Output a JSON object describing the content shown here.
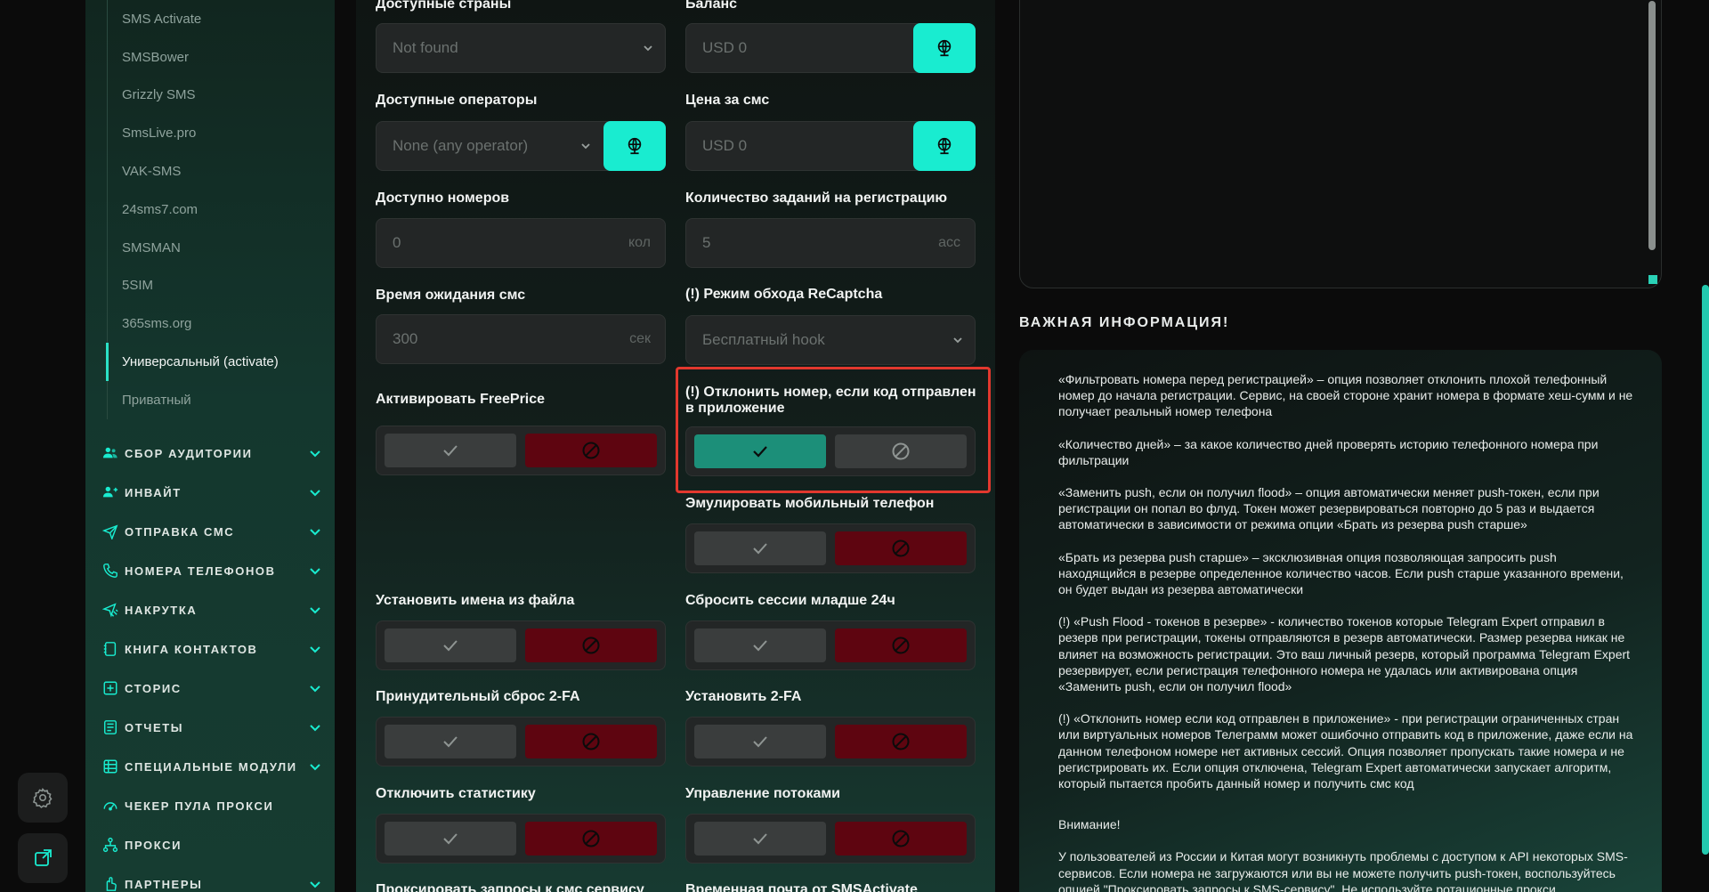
{
  "sidebar": {
    "sub_items": [
      "SMS Activate",
      "SMSBower",
      "Grizzly SMS",
      "SmsLive.pro",
      "VAK-SMS",
      "24sms7.com",
      "SMSMAN",
      "5SIM",
      "365sms.org",
      "Универсальный (activate)",
      "Приватный"
    ],
    "active_index": 9,
    "sections": [
      {
        "label": "СБОР АУДИТОРИИ",
        "icon": "users-icon"
      },
      {
        "label": "ИНВАЙТ",
        "icon": "user-add-icon"
      },
      {
        "label": "ОТПРАВКА СМС",
        "icon": "send-icon"
      },
      {
        "label": "НОМЕРА ТЕЛЕФОНОВ",
        "icon": "phone-icon"
      },
      {
        "label": "НАКРУТКА",
        "icon": "boost-icon"
      },
      {
        "label": "КНИГА КОНТАКТОВ",
        "icon": "contacts-book-icon"
      },
      {
        "label": "СТОРИС",
        "icon": "plus-square-icon"
      },
      {
        "label": "ОТЧЕТЫ",
        "icon": "report-icon"
      },
      {
        "label": "СПЕЦИАЛЬНЫЕ МОДУЛИ",
        "icon": "modules-icon"
      },
      {
        "label": "ЧЕКЕР ПУЛА ПРОКСИ",
        "icon": "gauge-icon"
      },
      {
        "label": "ПРОКСИ",
        "icon": "network-icon"
      },
      {
        "label": "ПАРТНЕРЫ",
        "icon": "hand-icon"
      }
    ]
  },
  "form": {
    "countries": {
      "label": "Доступные страны",
      "value": "Not found"
    },
    "balance": {
      "label": "Баланс",
      "value": "USD  0"
    },
    "operators": {
      "label": "Доступные операторы",
      "value": "None (any operator)"
    },
    "sms_price": {
      "label": "Цена за смс",
      "value": "USD  0"
    },
    "numbers_available": {
      "label": "Доступно номеров",
      "value": "0",
      "suffix": "кол"
    },
    "tasks_count": {
      "label": "Количество заданий на регистрацию",
      "value": "5",
      "suffix": "acc"
    },
    "sms_wait": {
      "label": "Время ожидания смс",
      "value": "300",
      "suffix": "сек"
    },
    "recaptcha": {
      "label": "(!) Режим обхода ReCaptcha",
      "value": "Бесплатный hook"
    },
    "freeprice": {
      "label": "Активировать FreePrice"
    },
    "reject_app_code": {
      "label_line1": "(!) Отклонить номер, если код отправлен",
      "label_line2": "в приложение"
    },
    "emulate_mobile": {
      "label": "Эмулировать мобильный телефон"
    },
    "names_from_file": {
      "label": "Установить имена из файла"
    },
    "reset_sessions": {
      "label": "Сбросить сессии младше 24ч"
    },
    "force_reset_2fa": {
      "label": "Принудительный сброс 2-FA"
    },
    "set_2fa": {
      "label": "Установить 2-FA"
    },
    "disable_stats": {
      "label": "Отключить статистику"
    },
    "thread_control": {
      "label": "Управление потоками"
    },
    "proxy_requests": {
      "label": "Проксировать запросы к смс сервису"
    },
    "temp_mail": {
      "label": "Временная почта от SMSActivate"
    }
  },
  "info": {
    "title": "ВАЖНАЯ ИНФОРМАЦИЯ!",
    "p1": "«Фильтровать номера перед регистрацией» – опция позволяет отклонить плохой телефонный номер до начала регистрации. Сервис, на своей стороне хранит номера в формате хеш-сумм и не получает реальный номер телефона",
    "p2": "«Количество дней» – за какое количество дней проверять историю телефонного номера при фильтрации",
    "p3": "«Заменить push, если он получил flood» – опция автоматически меняет push-токен, если при регистрации он попал во флуд. Токен может резервироваться повторно до 5 раз и выдается автоматически в зависимости от режима опции «Брать из резерва push старше»",
    "p4": "«Брать из резерва push старше» – эксклюзивная опция позволяющая запросить push находящийся в резерве определенное количество часов. Если push старше указанного времени, он будет выдан из резерва автоматически",
    "p5": "(!) «Push Flood - токенов в резерве» - количество токенов которые Telegram Expert отправил в резерв при регистрации, токены отправляются в резерв автоматически. Размер резерва никак не влияет на возможность регистрации. Это ваш личный резерв, который программа Telegram Expert резервирует, если регистрация телефонного номера не удалась или активирована опция «Заменить push, если он получил flood»",
    "p6": "(!) «Отклонить номер если код отправлен в приложение» - при регистрации ограниченных стран или виртуальных номеров Телеграмм может ошибочно отправить код в приложение, даже если на данном телефоном номере нет активных сессий. Опция позволяет пропускать такие номера и не регистрировать их. Если опция отключена, Telegram Expert автоматически запускает алгоритм, который пытается пробить данный номер и получить смс код",
    "p7": "Внимание!",
    "p8": "У пользователей из России и Китая могут возникнуть проблемы с доступом к API некоторых SMS-сервисов. Если номера не загружаются или вы не можете получить push-токен, воспользуйтесь опцией \"Проксировать запросы к SMS-сервису\". Не используйте ротационные прокси."
  },
  "colors": {
    "accent": "#19ecd0",
    "on": "#1c8f79",
    "off": "#5e0510",
    "highlight": "#e2382e"
  }
}
